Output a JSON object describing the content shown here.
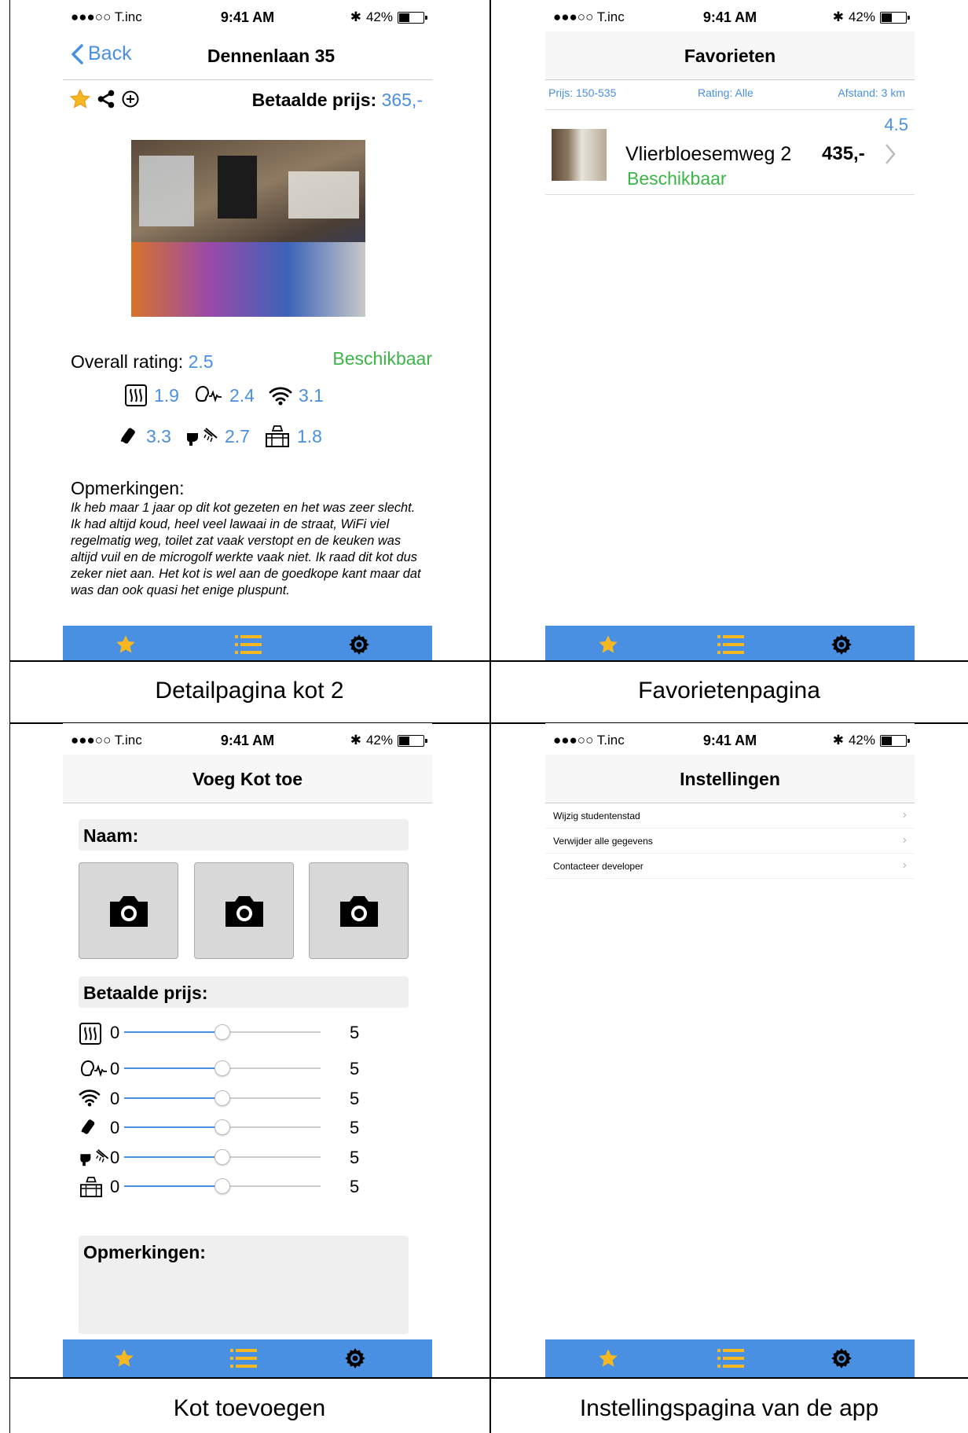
{
  "status": {
    "carrier": "●●●○○ T.inc",
    "time": "9:41 AM",
    "battery": "42%"
  },
  "colors": {
    "accent": "#4a90e2",
    "available": "#3cb548",
    "tabbar": "#4a90e2"
  },
  "captions": {
    "detail": "Detailpagina kot 2",
    "favorites": "Favorietenpagina",
    "add": "Kot toevoegen",
    "settings": "Instellingspagina van de app"
  },
  "detail": {
    "back_label": "Back",
    "title": "Dennenlaan 35",
    "price_label": "Betaalde prijs:",
    "price_value": "365,-",
    "overall_label": "Overall rating:",
    "overall_value": "2.5",
    "availability": "Beschikbaar",
    "ratings": [
      {
        "icon": "heating-icon",
        "value": "1.9"
      },
      {
        "icon": "noise-icon",
        "value": "2.4"
      },
      {
        "icon": "wifi-icon",
        "value": "3.1"
      },
      {
        "icon": "pest-control-icon",
        "value": "3.3"
      },
      {
        "icon": "sanitary-icon",
        "value": "2.7"
      },
      {
        "icon": "kitchen-icon",
        "value": "1.8"
      }
    ],
    "remarks_title": "Opmerkingen:",
    "remarks_text": "Ik heb maar 1 jaar op dit kot gezeten en het was zeer slecht. Ik had altijd koud, heel veel lawaai in de straat, WiFi viel regelmatig weg, toilet zat vaak verstopt en de keuken was altijd vuil en de microgolf werkte vaak niet. Ik raad dit kot dus zeker niet aan. Het kot is wel aan de goedkope kant maar dat was dan ook quasi het enige pluspunt."
  },
  "favorites": {
    "title": "Favorieten",
    "filter_price": "Prijs: 150-535",
    "filter_rating": "Rating: Alle",
    "filter_distance": "Afstand: 3 km",
    "items": [
      {
        "name": "Vlierbloesemweg 2",
        "price": "435,-",
        "rating": "4.5",
        "status": "Beschikbaar"
      }
    ]
  },
  "add": {
    "title": "Voeg Kot toe",
    "name_label": "Naam:",
    "price_label": "Betaalde prijs:",
    "slider_min": "0",
    "slider_max": "5",
    "sliders": [
      {
        "icon": "heating-icon",
        "value": 0.5
      },
      {
        "icon": "noise-icon",
        "value": 0.5
      },
      {
        "icon": "wifi-icon",
        "value": 0.5
      },
      {
        "icon": "pest-control-icon",
        "value": 0.5
      },
      {
        "icon": "sanitary-icon",
        "value": 0.5
      },
      {
        "icon": "kitchen-icon",
        "value": 0.5
      }
    ],
    "remarks_label": "Opmerkingen:"
  },
  "settings": {
    "title": "Instellingen",
    "items": [
      {
        "label": "Wijzig studentenstad"
      },
      {
        "label": "Verwijder alle gegevens"
      },
      {
        "label": "Contacteer developer"
      }
    ]
  }
}
